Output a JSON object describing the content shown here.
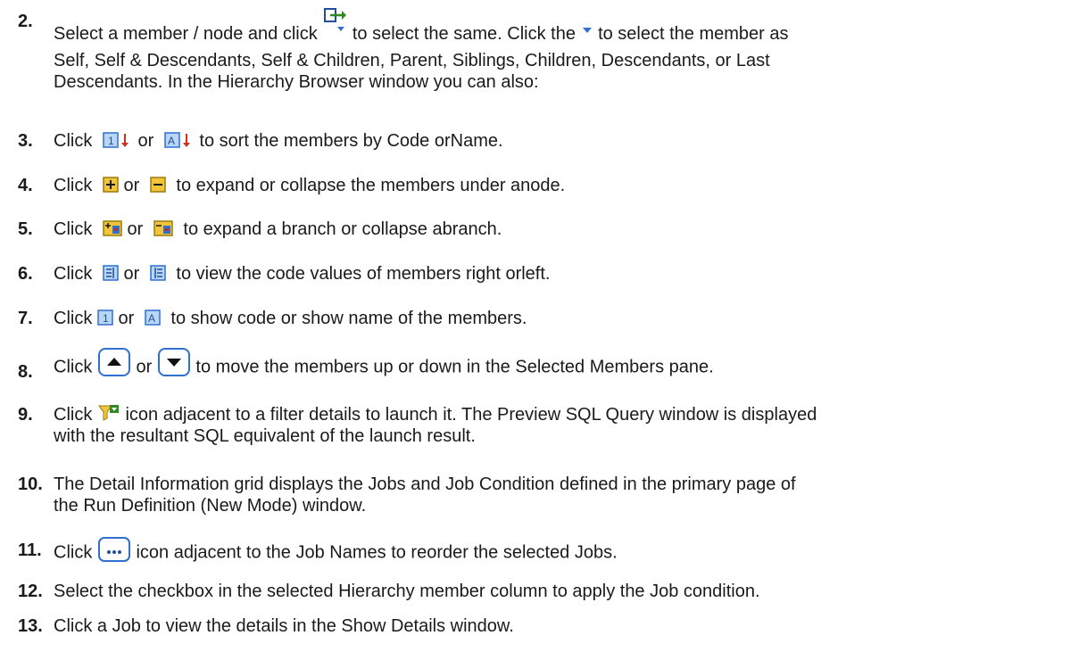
{
  "steps": [
    {
      "number": "2.",
      "parts": [
        "Select a member / node and click",
        "to select the same. Click the",
        "to select the member as",
        "Self, Self & Descendants, Self & Children, Parent, Siblings, Children, Descendants, or Last",
        "Descendants. In the Hierarchy Browser window you can also:"
      ],
      "icons": [
        "select-member-dropdown-icon",
        "dropdown-arrow-icon"
      ]
    },
    {
      "number": "3.",
      "parts": [
        "Click",
        "or",
        "to sort the members by Code orName."
      ],
      "icons": [
        "sort-by-code-icon",
        "sort-by-name-icon"
      ]
    },
    {
      "number": "4.",
      "parts": [
        "Click",
        "or",
        "to expand or collapse the members under anode."
      ],
      "icons": [
        "expand-icon",
        "collapse-icon"
      ]
    },
    {
      "number": "5.",
      "parts": [
        "Click",
        "or",
        "to expand a branch or collapse abranch."
      ],
      "icons": [
        "expand-branch-icon",
        "collapse-branch-icon"
      ]
    },
    {
      "number": "6.",
      "parts": [
        "Click",
        "or",
        "to view the code values of members right orleft."
      ],
      "icons": [
        "code-right-icon",
        "code-left-icon"
      ]
    },
    {
      "number": "7.",
      "parts": [
        "Click",
        "or",
        "to show code or show name of the members."
      ],
      "icons": [
        "show-code-icon",
        "show-name-icon"
      ]
    },
    {
      "number": "8.",
      "parts": [
        "Click",
        "or",
        "to move the members up or down in the Selected Members pane."
      ],
      "icons": [
        "move-up-icon",
        "move-down-icon"
      ]
    },
    {
      "number": "9.",
      "parts": [
        "Click",
        "icon adjacent to a filter details to launch it. The Preview SQL Query window is displayed",
        "with the resultant SQL equivalent of the launch result."
      ],
      "icons": [
        "filter-icon"
      ]
    },
    {
      "number": "10.",
      "parts": [
        "The Detail Information grid displays the Jobs and Job Condition defined in the primary page of",
        "the Run Definition (New Mode) window."
      ],
      "icons": []
    },
    {
      "number": "11.",
      "parts": [
        "Click",
        "icon adjacent to the Job Names to reorder the selected Jobs."
      ],
      "icons": [
        "ellipsis-icon"
      ]
    },
    {
      "number": "12.",
      "parts": [
        "Select the checkbox in the selected Hierarchy member column to apply the Job condition."
      ],
      "icons": []
    },
    {
      "number": "13.",
      "parts": [
        "Click a Job to view the details in the Show Details window."
      ],
      "icons": []
    }
  ],
  "colors": {
    "text": "#1a1a1a",
    "icon_blue": "#2f6fd0",
    "icon_fill": "#b9d7f5",
    "icon_yellow": "#f2c43a",
    "icon_green": "#2f8a1f"
  }
}
